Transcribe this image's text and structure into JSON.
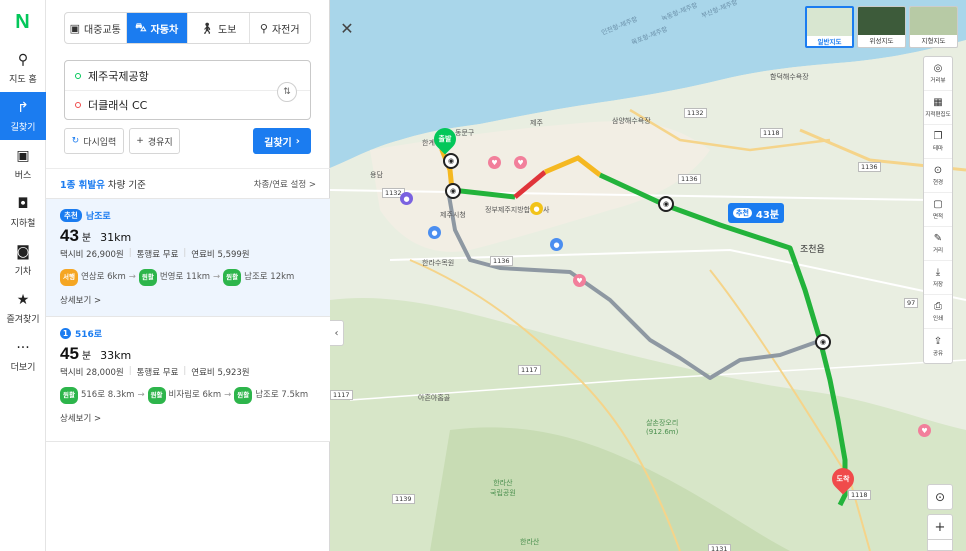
{
  "nav": {
    "logo": "N",
    "items": [
      {
        "label": "지도 홈",
        "icon": "map-pin-icon",
        "glyph": "⚲"
      },
      {
        "label": "길찾기",
        "icon": "directions-icon",
        "glyph": "↱"
      },
      {
        "label": "버스",
        "icon": "bus-icon",
        "glyph": "▣"
      },
      {
        "label": "지하철",
        "icon": "subway-icon",
        "glyph": "◘"
      },
      {
        "label": "기차",
        "icon": "train-icon",
        "glyph": "◙"
      },
      {
        "label": "즐겨찾기",
        "icon": "star-icon",
        "glyph": "★"
      },
      {
        "label": "더보기",
        "icon": "more-icon",
        "glyph": "···"
      }
    ]
  },
  "modes": {
    "transit": "대중교통",
    "car": "자동차",
    "walk": "도보",
    "bike": "자전거"
  },
  "close_glyph": "✕",
  "inputs": {
    "origin": "제주국제공항",
    "destination": "더클래식 CC",
    "swap_glyph": "⇅"
  },
  "actions": {
    "reset": "다시입력",
    "via": "경유지",
    "search": "길찾기"
  },
  "vehicle": {
    "type": "1종 휘발유",
    "suffix": "차량 기준",
    "settings": "차종/연료 설정 >"
  },
  "routes": [
    {
      "tag": "추천",
      "name": "남조로",
      "minutes": "43",
      "min_unit": "분",
      "distance": "31km",
      "taxi": "택시비 26,900원",
      "toll": "통행료 무료",
      "fuel": "연료비 5,599원",
      "via": [
        {
          "badge": "서행",
          "badge_color": "orange",
          "text": "연삼로 6km"
        },
        {
          "badge": "원활",
          "badge_color": "green",
          "text": "번영로 11km"
        },
        {
          "badge": "원활",
          "badge_color": "green",
          "text": "남조로 12km"
        }
      ],
      "detail": "상세보기 >"
    },
    {
      "tag": "1",
      "name": "516로",
      "minutes": "45",
      "min_unit": "분",
      "distance": "33km",
      "taxi": "택시비 28,000원",
      "toll": "통행료 무료",
      "fuel": "연료비 5,923원",
      "via": [
        {
          "badge": "원활",
          "badge_color": "green",
          "text": "516로 8.3km"
        },
        {
          "badge": "원활",
          "badge_color": "green",
          "text": "비자림로 6km"
        },
        {
          "badge": "원활",
          "badge_color": "green",
          "text": "남조로 7.5km"
        }
      ],
      "detail": "상세보기 >"
    }
  ],
  "map": {
    "route_label": {
      "tag": "추천",
      "time": "43분"
    },
    "start_label": "출발",
    "end_label": "도착",
    "map_types": [
      {
        "label": "일반지도",
        "active": true
      },
      {
        "label": "위성지도",
        "active": false
      },
      {
        "label": "지형지도",
        "active": false
      }
    ],
    "tools": [
      {
        "label": "거리뷰",
        "icon": "streetview-icon",
        "glyph": "◎"
      },
      {
        "label": "지적편집도",
        "icon": "cadastral-icon",
        "glyph": "▦"
      },
      {
        "label": "테마",
        "icon": "theme-icon",
        "glyph": "❐"
      },
      {
        "label": "현경",
        "icon": "boundary-icon",
        "glyph": "⊙"
      },
      {
        "label": "면적",
        "icon": "area-icon",
        "glyph": "▢"
      },
      {
        "label": "거리",
        "icon": "ruler-icon",
        "glyph": "✎"
      },
      {
        "label": "저장",
        "icon": "download-icon",
        "glyph": "⤓"
      },
      {
        "label": "인쇄",
        "icon": "print-icon",
        "glyph": "⎙"
      },
      {
        "label": "공유",
        "icon": "share-icon",
        "glyph": "⇪"
      }
    ],
    "places": {
      "jeju_city_hall": "제주시청",
      "jocheon": "조천읍",
      "hallasan_arboretum": "한라수목원",
      "ahop_forest": "아흔아홉골",
      "samseonghyeol": "삼양해수욕장",
      "hamdeok": "함덕해수욕장",
      "gov_complex": "정부제주지방합동청사",
      "saemsilori": "살손장오리\n(912.6m)",
      "hallasan_park": "한라산\n국립공원",
      "hallasan": "한라산",
      "yongdam": "용담",
      "dongmun": "동문구",
      "jejudo": "제주도",
      "jejumark": "제주",
      "iho": "한계",
      "sea1": "인천항-제주항",
      "sea2": "목포항-제주항",
      "sea3": "녹동항-제주항",
      "sea4": "부산항-제주항"
    },
    "road_numbers": [
      "1132",
      "1118",
      "1136",
      "1136",
      "1132",
      "1136",
      "1117",
      "1117",
      "97",
      "1139",
      "1118",
      "1131"
    ]
  }
}
